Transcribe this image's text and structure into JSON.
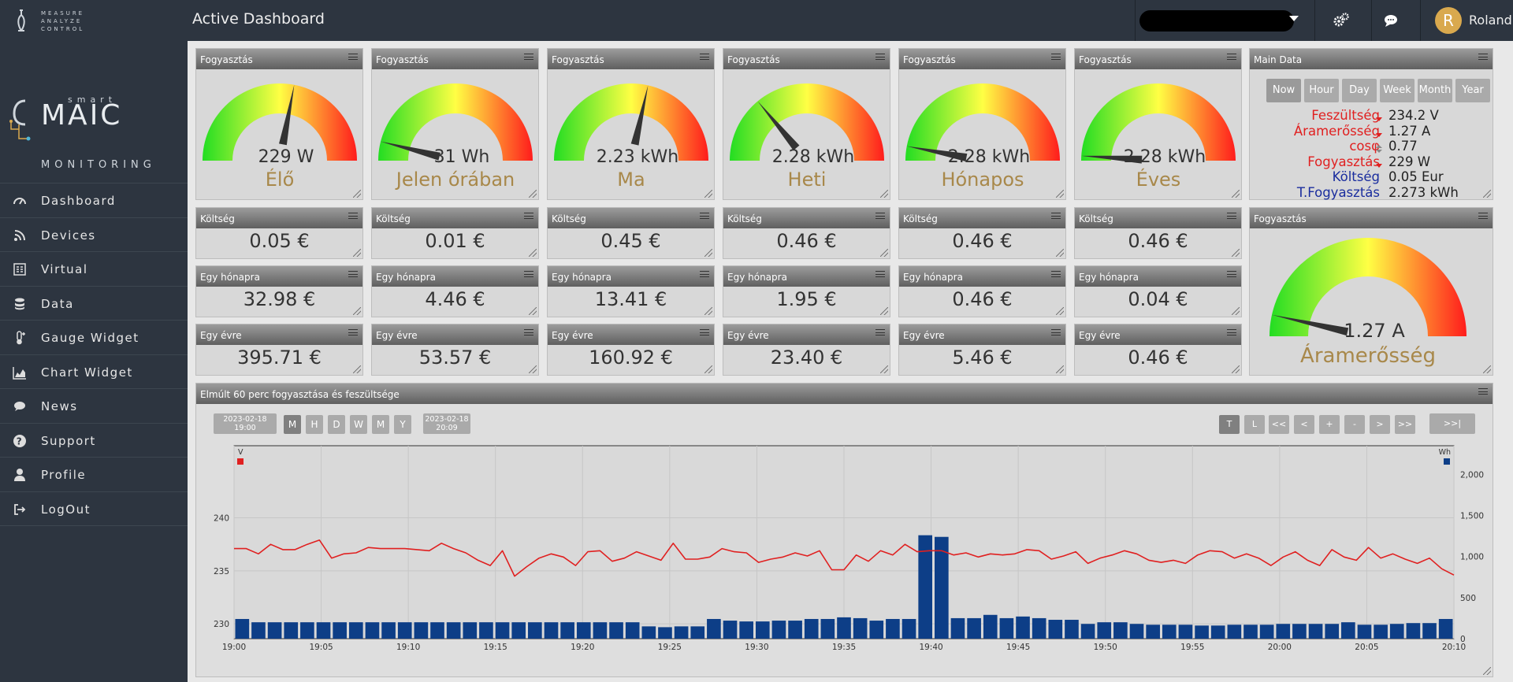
{
  "header": {
    "title": "Active Dashboard",
    "user_name": "Roland",
    "avatar_initial": "R",
    "logo_lines": [
      "MEASURE",
      "ANALYZE",
      "CONTROL"
    ]
  },
  "sidebar": {
    "brand_small": "smart",
    "brand": "MAIC",
    "subtitle": "MONITORING",
    "items": [
      {
        "label": "Dashboard",
        "icon": "gauge-icon"
      },
      {
        "label": "Devices",
        "icon": "rss-icon"
      },
      {
        "label": "Virtual",
        "icon": "grid-icon"
      },
      {
        "label": "Data",
        "icon": "database-icon"
      },
      {
        "label": "Gauge Widget",
        "icon": "thermometer-icon"
      },
      {
        "label": "Chart Widget",
        "icon": "area-chart-icon"
      },
      {
        "label": "News",
        "icon": "comments-icon"
      },
      {
        "label": "Support",
        "icon": "question-icon"
      },
      {
        "label": "Profile",
        "icon": "user-icon"
      },
      {
        "label": "LogOut",
        "icon": "sign-out-icon"
      }
    ]
  },
  "gauges": [
    {
      "title": "Fogyasztás",
      "value": "229 W",
      "label": "Élő",
      "needle": 0.56
    },
    {
      "title": "Fogyasztás",
      "value": "31 Wh",
      "label": "Jelen órában",
      "needle": 0.08
    },
    {
      "title": "Fogyasztás",
      "value": "2.23 kWh",
      "label": "Ma",
      "needle": 0.57
    },
    {
      "title": "Fogyasztás",
      "value": "2.28 kWh",
      "label": "Heti",
      "needle": 0.28
    },
    {
      "title": "Fogyasztás",
      "value": "2.28 kWh",
      "label": "Hónapos",
      "needle": 0.06
    },
    {
      "title": "Fogyasztás",
      "value": "2.28 kWh",
      "label": "Éves",
      "needle": 0.02
    }
  ],
  "cost_rows": [
    {
      "title": "Költség",
      "values": [
        "0.05 €",
        "0.01 €",
        "0.45 €",
        "0.46 €",
        "0.46 €",
        "0.46 €"
      ]
    },
    {
      "title": "Egy hónapra",
      "values": [
        "32.98 €",
        "4.46 €",
        "13.41 €",
        "1.95 €",
        "0.46 €",
        "0.04 €"
      ]
    },
    {
      "title": "Egy évre",
      "values": [
        "395.71 €",
        "53.57 €",
        "160.92 €",
        "23.40 €",
        "5.46 €",
        "0.46 €"
      ]
    }
  ],
  "main_data": {
    "title": "Main Data",
    "buttons": [
      "Now",
      "Hour",
      "Day",
      "Week",
      "Month",
      "Year"
    ],
    "rows": [
      {
        "label": "Feszültség",
        "value": "234.2 V",
        "color": "#e02020",
        "arrow": "down"
      },
      {
        "label": "Áramerősség",
        "value": "1.27 A",
        "color": "#e02020",
        "arrow": "down"
      },
      {
        "label": "cosφ",
        "value": "0.77",
        "color": "#e02020",
        "arrow": "updown"
      },
      {
        "label": "Fogyasztás",
        "value": "229 W",
        "color": "#e02020",
        "arrow": "down"
      },
      {
        "label": "Költség",
        "value": "0.05 Eur",
        "color": "#1a2d9e",
        "arrow": ""
      },
      {
        "label": "T.Fogyasztás",
        "value": "2.273 kWh",
        "color": "#1a2d9e",
        "arrow": ""
      }
    ]
  },
  "big_gauge": {
    "title": "Fogyasztás",
    "value": "1.27 A",
    "label": "Áramerősség",
    "needle": 0.07
  },
  "chart_panel": {
    "title": "Elmúlt 60 perc fogyasztása és feszültsége",
    "date_from": [
      "2023-02-18",
      "19:00"
    ],
    "date_to": [
      "2023-02-18",
      "20:09"
    ],
    "period_buttons": [
      "M",
      "H",
      "D",
      "W",
      "M",
      "Y"
    ],
    "nav_buttons": [
      "T",
      "L",
      "<<",
      "<",
      "+",
      "-",
      ">",
      ">>"
    ],
    "end_button": ">>|"
  },
  "chart_data": {
    "type": "bar+line",
    "x_ticks": [
      "19:00",
      "19:05",
      "19:10",
      "19:15",
      "19:20",
      "19:25",
      "19:30",
      "19:35",
      "19:40",
      "19:45",
      "19:50",
      "19:55",
      "20:00",
      "20:05",
      "20:10"
    ],
    "left_axis": {
      "label": "V",
      "ticks": [
        230,
        235,
        240
      ],
      "range": [
        228.6,
        246.8
      ]
    },
    "right_axis": {
      "label": "Wh",
      "ticks": [
        "0",
        "500",
        "1,000",
        "1,500",
        "2,000"
      ],
      "range": [
        0,
        2350
      ]
    },
    "bars_wh": [
      240,
      200,
      200,
      200,
      200,
      200,
      200,
      200,
      200,
      200,
      200,
      200,
      200,
      200,
      200,
      200,
      200,
      200,
      200,
      200,
      200,
      200,
      200,
      200,
      200,
      150,
      140,
      150,
      150,
      240,
      220,
      210,
      210,
      220,
      220,
      240,
      240,
      260,
      250,
      220,
      240,
      240,
      1260,
      1240,
      250,
      250,
      290,
      250,
      270,
      250,
      230,
      230,
      180,
      200,
      200,
      180,
      170,
      170,
      170,
      160,
      160,
      170,
      170,
      170,
      180,
      180,
      180,
      180,
      200,
      170,
      170,
      180,
      190,
      190,
      240
    ],
    "line_v": [
      237.1,
      237.1,
      236.6,
      237.5,
      237.0,
      237.0,
      237.5,
      237.9,
      236.2,
      236.6,
      236.7,
      237.2,
      237.1,
      237.1,
      237.1,
      237.0,
      236.9,
      237.6,
      237.1,
      236.7,
      236.0,
      235.5,
      236.9,
      234.5,
      235.4,
      236.2,
      236.6,
      236.3,
      235.5,
      236.8,
      236.9,
      235.9,
      236.2,
      236.8,
      236.4,
      236.0,
      237.6,
      236.1,
      236.1,
      236.3,
      237.1,
      236.8,
      236.7,
      235.8,
      236.1,
      236.3,
      236.7,
      236.4,
      236.9,
      235.1,
      235.1,
      236.5,
      235.9,
      236.9,
      236.5,
      237.5,
      236.8,
      236.9,
      236.9,
      236.5,
      236.7,
      236.3,
      236.6,
      236.5,
      236.6,
      237.0,
      236.9,
      236.1,
      236.4,
      236.8,
      235.7,
      236.2,
      236.5,
      236.9,
      236.6,
      236.0,
      235.8,
      236.0,
      235.7,
      236.5,
      236.9,
      236.8,
      236.2,
      236.6,
      236.2,
      235.5,
      236.3,
      236.8,
      236.0,
      235.5,
      237.0,
      236.3,
      236.0,
      237.2,
      236.2,
      236.6,
      236.1,
      235.7,
      236.2,
      235.2,
      234.6
    ],
    "series": [
      {
        "name": "V",
        "color": "#e02020"
      },
      {
        "name": "Wh",
        "color": "#0d3e87"
      }
    ]
  }
}
